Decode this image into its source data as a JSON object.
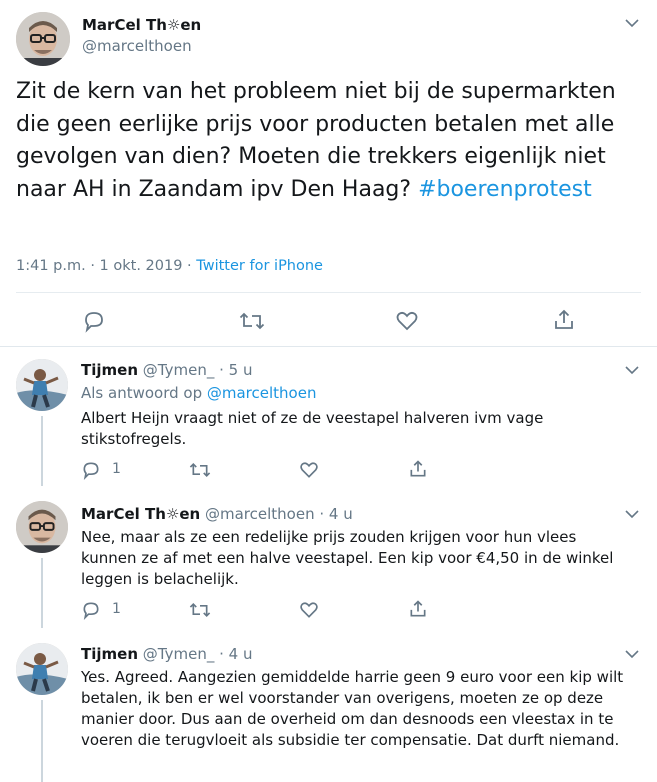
{
  "main_tweet": {
    "author_name": "MarCel Th☼en",
    "author_handle": "@marcelthoen",
    "text_before_hashtag": "Zit de kern van het probleem niet bij de supermarkten die geen eerlijke prijs voor producten betalen met alle gevolgen van dien? Moeten die trekkers eigenlijk niet naar AH in Zaandam ipv Den Haag? ",
    "hashtag": "#boerenprotest",
    "timestamp": "1:41 p.m. · 1 okt. 2019 · ",
    "source": "Twitter for iPhone"
  },
  "replies": [
    {
      "author_name": "Tijmen",
      "author_handle": "@Tymen_",
      "age": "· 5 u",
      "reply_to_label": "Als antwoord op ",
      "reply_to_handle": "@marcelthoen",
      "text": "Albert Heijn vraagt niet of ze de veestapel halveren ivm vage stikstofregels.",
      "reply_count": "1"
    },
    {
      "author_name": "MarCel Th☼en",
      "author_handle": "@marcelthoen",
      "age": "· 4 u",
      "text": "Nee, maar als ze een redelijke prijs zouden krijgen voor hun vlees kunnen ze af met een halve veestapel. Een kip voor €4,50 in de winkel leggen is belachelijk.",
      "reply_count": "1"
    },
    {
      "author_name": "Tijmen",
      "author_handle": "@Tymen_",
      "age": "· 4 u",
      "text": "Yes. Agreed.  Aangezien gemiddelde harrie geen 9 euro voor een kip wilt betalen, ik ben er wel voorstander van overigens, moeten ze op deze manier door. Dus aan de overheid om dan desnoods een vleestax in te voeren die terugvloeit als subsidie ter compensatie. Dat durft niemand."
    }
  ],
  "colors": {
    "link": "#1b95e0",
    "muted": "#657786",
    "divider": "#e6ecf0"
  }
}
